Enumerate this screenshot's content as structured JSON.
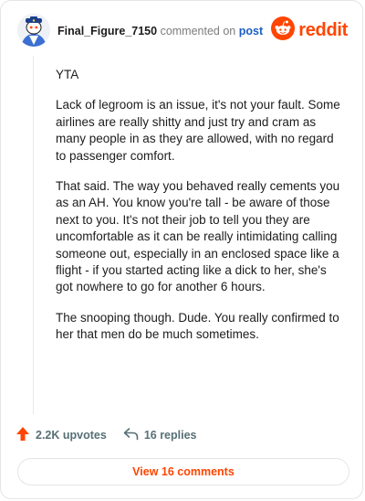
{
  "header": {
    "username": "Final_Figure_7150",
    "action_text": "commented on",
    "post_link": "post",
    "brand_name": "reddit"
  },
  "comment": {
    "paragraphs": [
      "YTA",
      "Lack of legroom is an issue, it's not your fault. Some airlines are really shitty and just try and cram as many people in as they are allowed, with no regard to passenger comfort.",
      "That said. The way you behaved really cements you as an AH. You know you're tall - be aware of those next to you. It's not their job to tell you they are uncomfortable as it can be really intimidating calling someone out, especially in an enclosed space like a flight - if you started acting like a dick to her, she's got nowhere to go for another 6 hours.",
      "The snooping though. Dude. You really confirmed to her that men do be much sometimes."
    ]
  },
  "actions": {
    "upvotes": "2.2K upvotes",
    "replies": "16 replies"
  },
  "view_button": {
    "label": "View 16 comments"
  },
  "icons": {
    "avatar": "snoo-avatar-icon",
    "brand": "reddit-logo-icon",
    "upvote": "upvote-arrow-icon",
    "reply": "reply-arrow-icon"
  },
  "colors": {
    "brand": "#ff4500",
    "link": "#1c5fc4",
    "text": "#1c1c1c",
    "muted": "#576f76"
  }
}
